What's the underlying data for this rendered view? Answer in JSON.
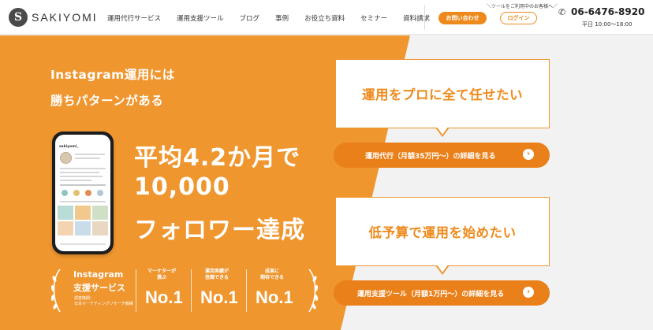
{
  "brand": {
    "logo_text": "SAKIYOMI",
    "logo_mark": "S"
  },
  "nav": [
    "運用代行サービス",
    "運用支援ツール",
    "ブログ",
    "事例",
    "お役立ち資料",
    "セミナー",
    "資料請求"
  ],
  "header": {
    "tool_hint": "ツールをご利用中のお客様へ",
    "contact_label": "お問い合わせ",
    "login_label": "ログイン",
    "phone": "06-6476-8920",
    "hours": "平日 10:00〜18:00"
  },
  "hero": {
    "subtitle_line1": "Instagram運用には",
    "subtitle_line2": "勝ちパターンがある",
    "headline_line1": "平均4.2か月で",
    "headline_line2": "10,000",
    "headline_line3": "フォロワー達成",
    "phone_mock_name": "sakiyomi_"
  },
  "awards": {
    "title_line1": "Instagram",
    "title_line2": "支援サービス",
    "source_line1": "調査機関：",
    "source_line2": "日本マーケティングリサーチ機構",
    "items": [
      {
        "line1": "マーケターが",
        "line2": "選ぶ",
        "rank": "No.1"
      },
      {
        "line1": "運用実績が",
        "line2": "信頼できる",
        "rank": "No.1"
      },
      {
        "line1": "成果に",
        "line2": "期待できる",
        "rank": "No.1"
      }
    ]
  },
  "panels": [
    {
      "bubble": "運用をプロに全て任せたい",
      "cta": "運用代行（月額35万円〜）の詳細を見る"
    },
    {
      "bubble": "低予算で運用を始めたい",
      "cta": "運用支援ツール（月額1万円〜）の詳細を見る"
    }
  ],
  "colors": {
    "accent": "#ef962f",
    "cta": "#ea801a",
    "background": "#f2f2f2"
  }
}
